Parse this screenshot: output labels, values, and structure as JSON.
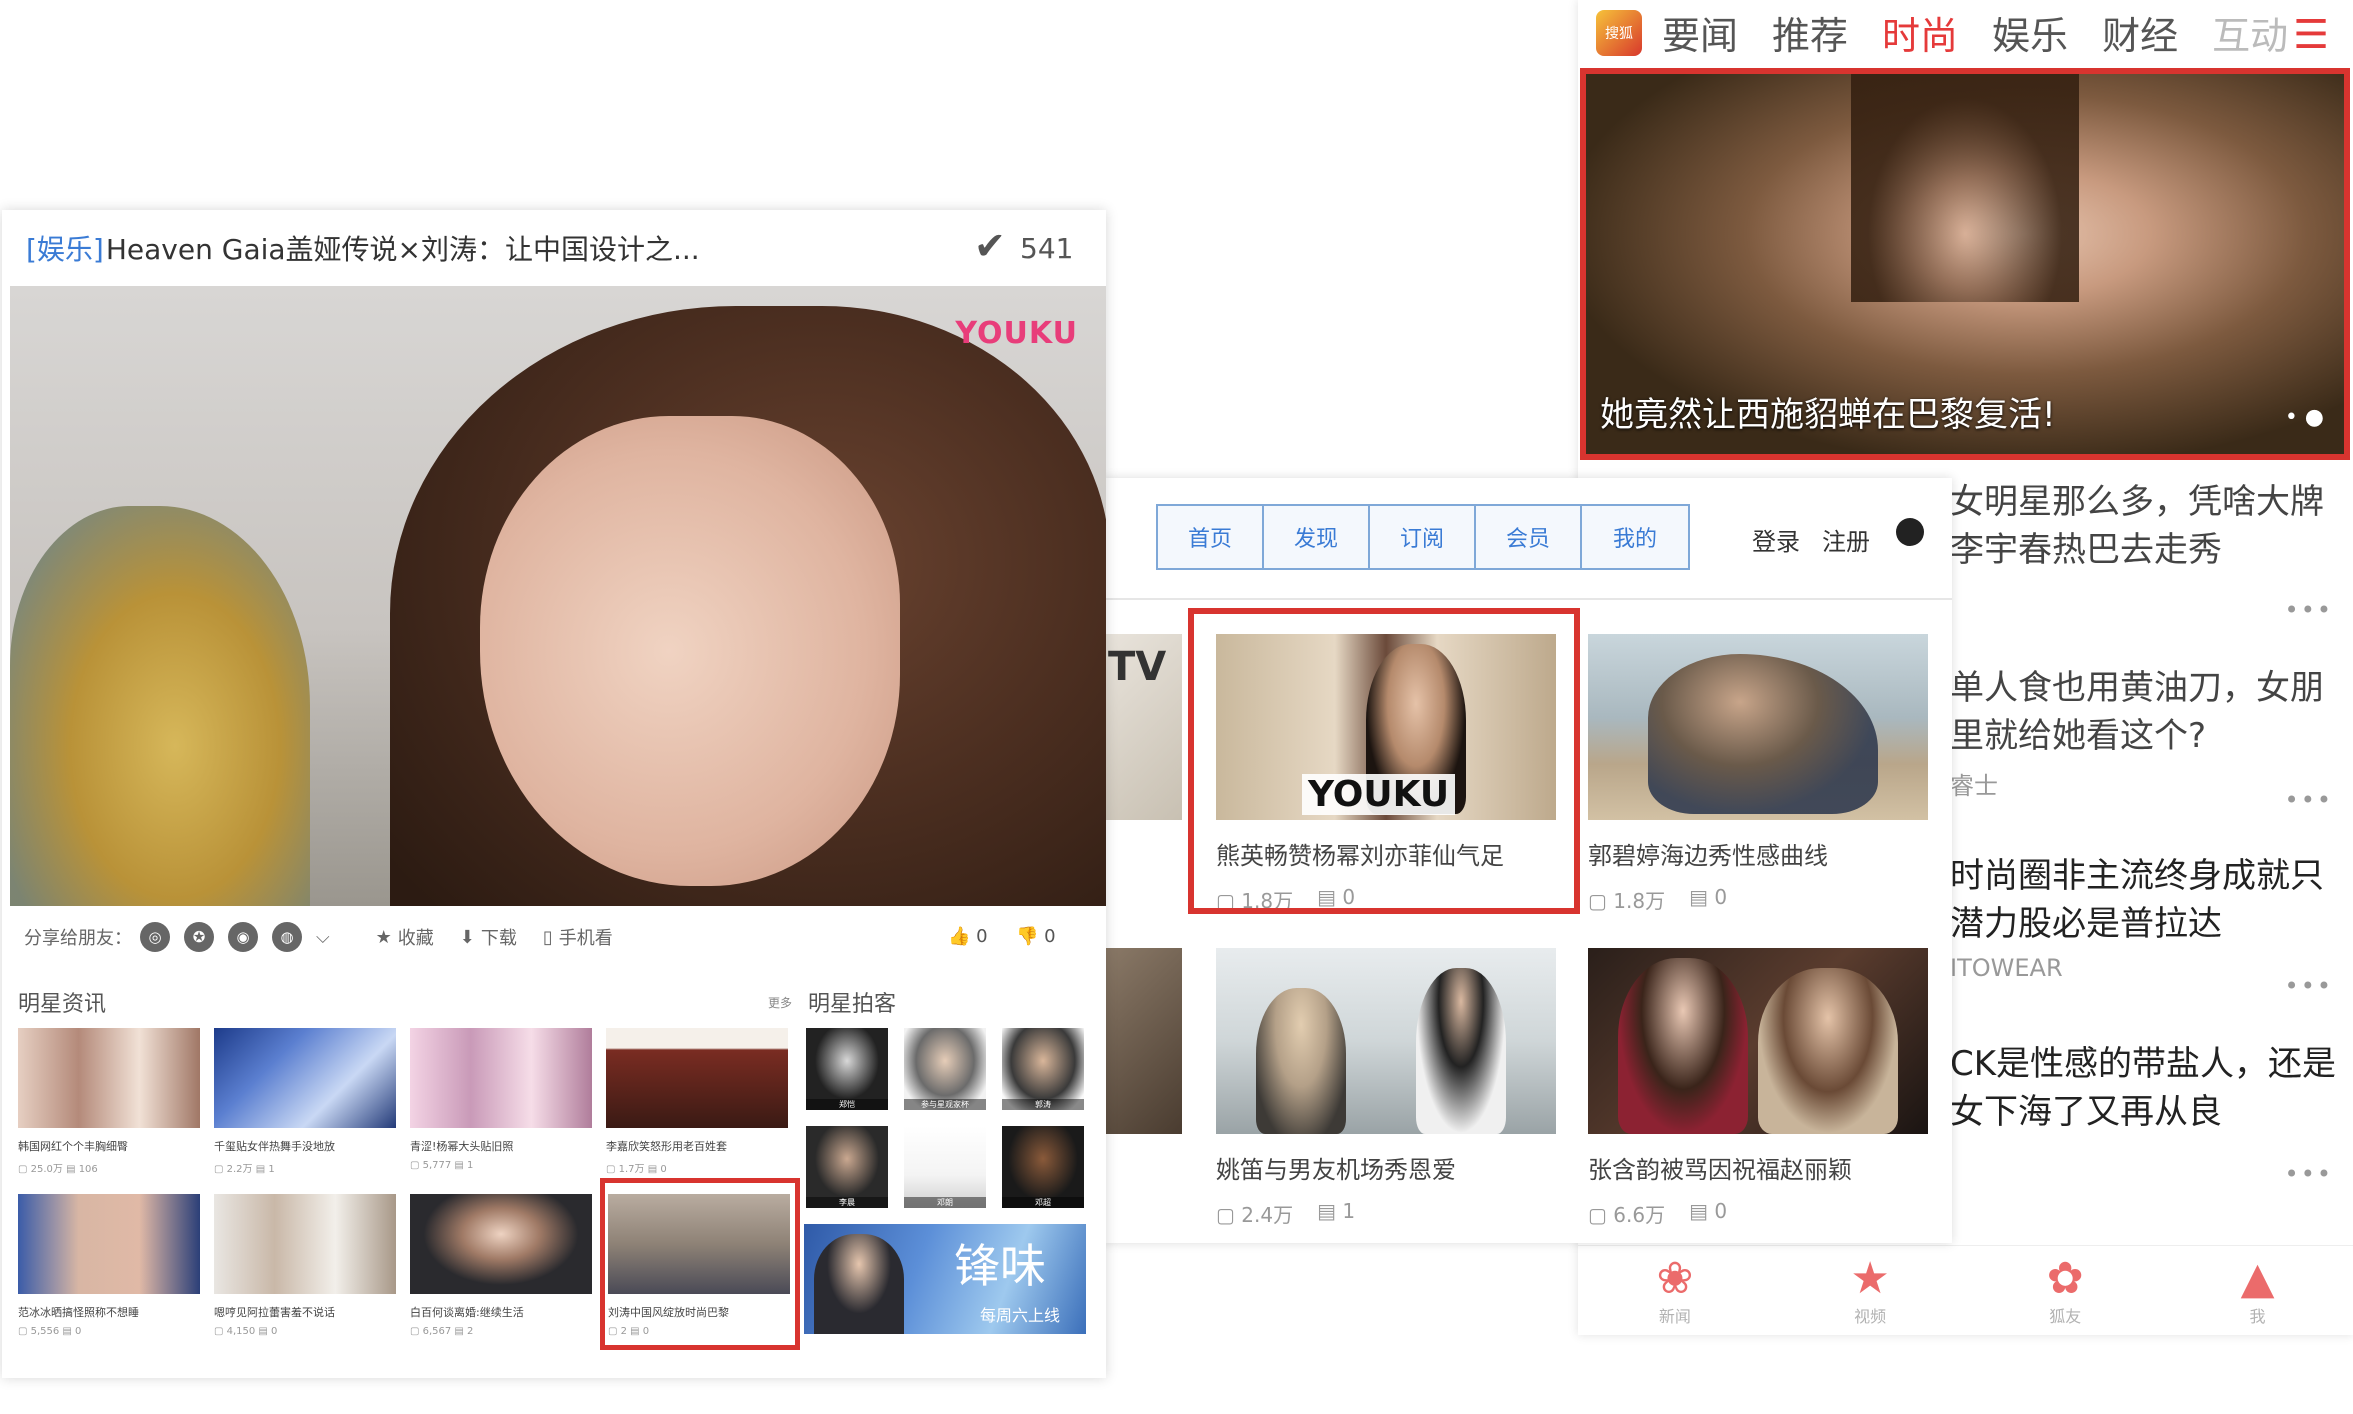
{
  "right_panel": {
    "logo": "搜狐",
    "tabs": [
      {
        "label": "要闻",
        "state": "normal"
      },
      {
        "label": "推荐",
        "state": "normal"
      },
      {
        "label": "时尚",
        "state": "active"
      },
      {
        "label": "娱乐",
        "state": "normal"
      },
      {
        "label": "财经",
        "state": "normal"
      },
      {
        "label": "互动",
        "state": "faded"
      }
    ],
    "menu_icon": "☰",
    "banner_caption": "她竟然让西施貂蝉在巴黎复活!",
    "banner_dots": "• ●",
    "list": [
      {
        "title": "女明星那么多，凭啥大牌李宇春热巴去走秀",
        "meta": ""
      },
      {
        "title": "单人食也用黄油刀，女朋里就给她看这个?",
        "meta": "睿士"
      },
      {
        "title": "时尚圈非主流终身成就只潜力股必是普拉达",
        "meta": "ITOWEAR"
      },
      {
        "title": "CK是性感的带盐人，还是女下海了又再从良",
        "meta": ""
      }
    ],
    "more": "•••",
    "bottom_nav": [
      {
        "icon": "❀",
        "label": "新闻"
      },
      {
        "icon": "★",
        "label": "视频"
      },
      {
        "icon": "✿",
        "label": "狐友"
      },
      {
        "icon": "▲",
        "label": "我"
      }
    ]
  },
  "mid_panel": {
    "nav": [
      "首页",
      "发现",
      "订阅",
      "会员",
      "我的"
    ],
    "login": "登录",
    "register": "注册",
    "cut_logo": "TV",
    "cards": [
      {
        "title": "熊英畅赞杨幂刘亦菲仙气足",
        "plays": "1.8万",
        "comments": "0",
        "logo": "YOUKU"
      },
      {
        "title": "郭碧婷海边秀性感曲线",
        "plays": "1.8万",
        "comments": "0"
      },
      {
        "title": "姚笛与男友机场秀恩爱",
        "plays": "2.4万",
        "comments": "1"
      },
      {
        "title": "张含韵被骂因祝福赵丽颖",
        "plays": "6.6万",
        "comments": "0"
      }
    ]
  },
  "left_panel": {
    "tag": "[娱乐]",
    "title": "Heaven Gaia盖娅传说×刘涛：让中国设计之...",
    "check_icon": "✔",
    "count": "541",
    "video_logo": "YOUKU",
    "share_label": "分享给朋友：",
    "share_icons": [
      {
        "name": "wechat-icon",
        "glyph": "◎"
      },
      {
        "name": "favorite-share-icon",
        "glyph": "✪"
      },
      {
        "name": "weibo-icon",
        "glyph": "◉"
      },
      {
        "name": "qq-icon",
        "glyph": "◍"
      }
    ],
    "share_more": "⌵",
    "actions": [
      {
        "name": "collect-button",
        "icon": "★",
        "label": "收藏"
      },
      {
        "name": "download-button",
        "icon": "⬇",
        "label": "下载"
      },
      {
        "name": "mobile-watch-button",
        "icon": "▯",
        "label": "手机看"
      }
    ],
    "likes": "0",
    "dislikes": "0",
    "star_news_title": "明星资讯",
    "star_news_more": "更多",
    "star_blog_title": "明星拍客",
    "news": [
      {
        "title": "韩国网红个个丰胸细臀",
        "meta": "▢ 25.0万  ▤ 106"
      },
      {
        "title": "千玺贴女伴热舞手没地放",
        "meta": "▢ 2.2万  ▤ 1"
      },
      {
        "title": "青涩!杨幂大头贴旧照",
        "meta": "▢ 5,777  ▤ 1"
      },
      {
        "title": "李嘉欣笑怒形用老百姓套",
        "meta": "▢ 1.7万  ▤ 0"
      },
      {
        "title": "范冰冰晒搞怪照称不想睡",
        "meta": "▢ 5,556  ▤ 0"
      },
      {
        "title": "嗯哼见阿拉蕾害羞不说话",
        "meta": "▢ 4,150  ▤ 0"
      },
      {
        "title": "白百何谈离婚:继续生活",
        "meta": "▢ 6,567  ▤ 2"
      },
      {
        "title": "刘涛中国风绽放时尚巴黎",
        "meta": "▢ 2  ▤ 0"
      }
    ],
    "stars": [
      {
        "label": "郑恺"
      },
      {
        "label": "参与星观家杯"
      },
      {
        "label": "郭涛"
      },
      {
        "label": "李晨"
      },
      {
        "label": "邓朗"
      },
      {
        "label": "邓超"
      }
    ],
    "promo_big": "锋味",
    "promo_sub": "每周六上线"
  }
}
